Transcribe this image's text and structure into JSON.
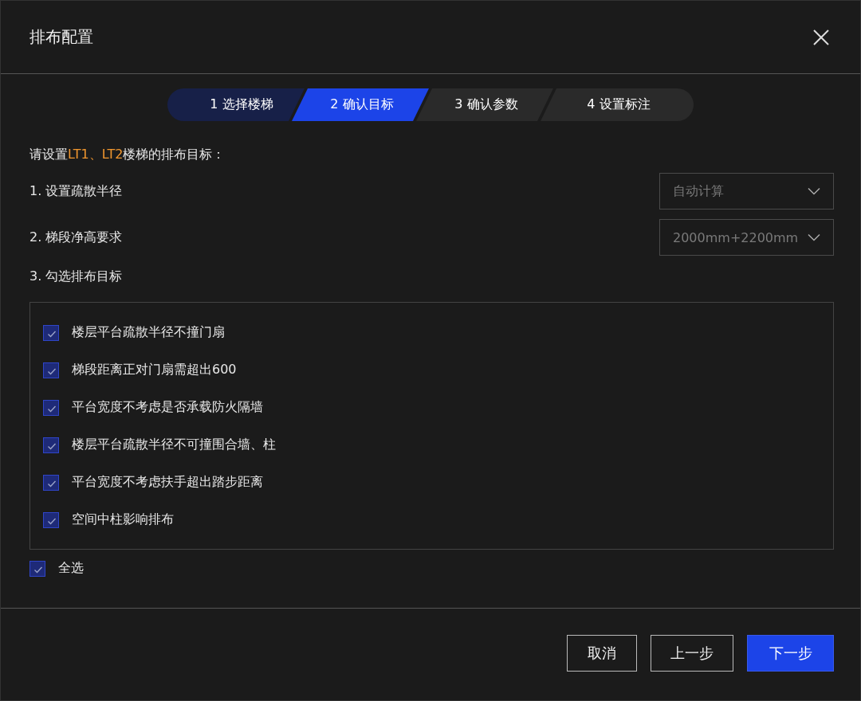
{
  "dialog": {
    "title": "排布配置"
  },
  "steps": [
    {
      "label": "1 选择楼梯",
      "completed": true,
      "selected": false
    },
    {
      "label": "2 确认目标",
      "completed": false,
      "selected": true
    },
    {
      "label": "3 确认参数",
      "completed": false,
      "selected": false
    },
    {
      "label": "4 设置标注",
      "completed": false,
      "selected": false
    }
  ],
  "intro": {
    "before": "请设置",
    "highlight": "LT1、LT2",
    "after": "楼梯的排布目标："
  },
  "settings": [
    {
      "label": "1. 设置疏散半径",
      "kind": "dropdown",
      "value": "自动计算"
    },
    {
      "label": "2. 梯段净高要求",
      "kind": "dropdown",
      "value": "2000mm+2200mm"
    },
    {
      "label": "3. 勾选排布目标",
      "kind": "heading"
    }
  ],
  "targets": [
    {
      "label": "楼层平台疏散半径不撞门扇",
      "checked": true
    },
    {
      "label": "梯段距离正对门扇需超出600",
      "checked": true
    },
    {
      "label": "平台宽度不考虑是否承载防火隔墙",
      "checked": true
    },
    {
      "label": "楼层平台疏散半径不可撞围合墙、柱",
      "checked": true
    },
    {
      "label": "平台宽度不考虑扶手超出踏步距离",
      "checked": true
    },
    {
      "label": "空间中柱影响排布",
      "checked": true
    }
  ],
  "select_all": {
    "label": "全选",
    "checked": true
  },
  "buttons": [
    {
      "label": "取消",
      "kind": "secondary"
    },
    {
      "label": "上一步",
      "kind": "secondary"
    },
    {
      "label": "下一步",
      "kind": "primary"
    }
  ]
}
